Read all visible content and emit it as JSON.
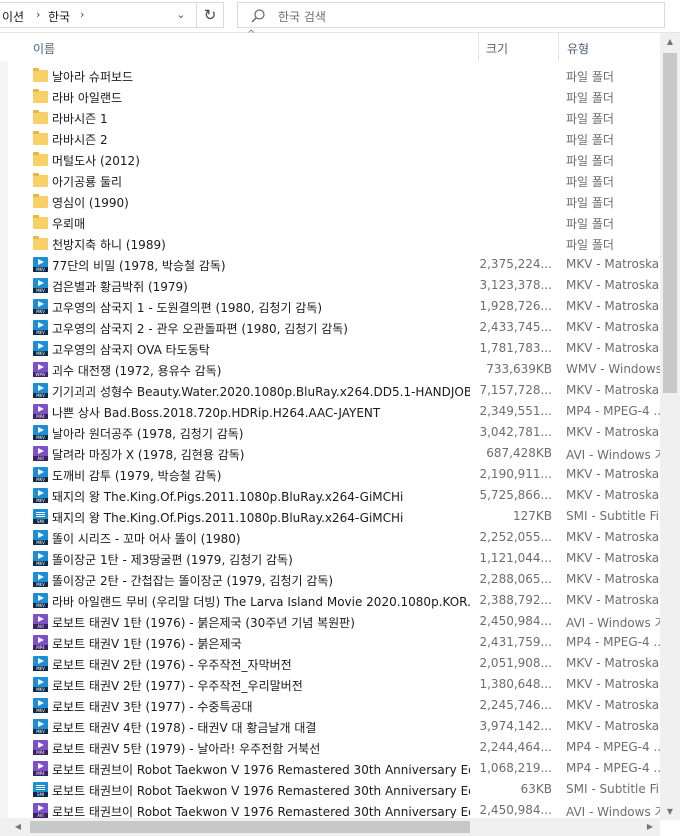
{
  "address": {
    "crumb1": "이션",
    "crumb2": "한국"
  },
  "search": {
    "placeholder": "한국 검색"
  },
  "header": {
    "name": "이름",
    "size": "크기",
    "type": "유형"
  },
  "rows": [
    {
      "icon": "folder",
      "name": "날아라 슈퍼보드",
      "size": "",
      "type": "파일 폴더"
    },
    {
      "icon": "folder",
      "name": "라바 아일랜드",
      "size": "",
      "type": "파일 폴더"
    },
    {
      "icon": "folder",
      "name": "라바시즌 1",
      "size": "",
      "type": "파일 폴더"
    },
    {
      "icon": "folder",
      "name": "라바시즌 2",
      "size": "",
      "type": "파일 폴더"
    },
    {
      "icon": "folder",
      "name": "머털도사 (2012)",
      "size": "",
      "type": "파일 폴더"
    },
    {
      "icon": "folder",
      "name": "아기공룡 둘리",
      "size": "",
      "type": "파일 폴더"
    },
    {
      "icon": "folder",
      "name": "영심이 (1990)",
      "size": "",
      "type": "파일 폴더"
    },
    {
      "icon": "folder",
      "name": "우뢰매",
      "size": "",
      "type": "파일 폴더"
    },
    {
      "icon": "folder",
      "name": "천방지축 하니 (1989)",
      "size": "",
      "type": "파일 폴더"
    },
    {
      "icon": "mkv",
      "name": "77단의 비밀 (1978, 박승철 감독)",
      "size": "2,375,224...",
      "type": "MKV - Matroska ..."
    },
    {
      "icon": "mkv",
      "name": "검은별과 황금박쥐 (1979)",
      "size": "3,123,378...",
      "type": "MKV - Matroska ..."
    },
    {
      "icon": "mkv",
      "name": "고우영의 삼국지 1 - 도원결의편 (1980, 김청기 감독)",
      "size": "1,928,726...",
      "type": "MKV - Matroska ..."
    },
    {
      "icon": "mkv",
      "name": "고우영의 삼국지 2 - 관우 오관돌파편 (1980, 김청기 감독)",
      "size": "2,433,745...",
      "type": "MKV - Matroska ..."
    },
    {
      "icon": "mkv",
      "name": "고우영의 삼국지 OVA 타도동탁",
      "size": "1,781,783...",
      "type": "MKV - Matroska ..."
    },
    {
      "icon": "wmv",
      "name": "괴수 대전쟁 (1972, 용유수 감독)",
      "size": "733,639KB",
      "type": "WMV - Windows ..."
    },
    {
      "icon": "mkv",
      "name": "기기괴괴 성형수 Beauty.Water.2020.1080p.BluRay.x264.DD5.1-HANDJOB",
      "size": "7,157,728...",
      "type": "MKV - Matroska ..."
    },
    {
      "icon": "mp4",
      "name": "나쁜 상사 Bad.Boss.2018.720p.HDRip.H264.AAC-JAYENT",
      "size": "2,349,551...",
      "type": "MP4 - MPEG-4 ..."
    },
    {
      "icon": "mkv",
      "name": "날아라 원더공주 (1978, 김청기 감독)",
      "size": "3,042,781...",
      "type": "MKV - Matroska ..."
    },
    {
      "icon": "avi",
      "name": "달려라 마징가 X (1978, 김현용 감독)",
      "size": "687,428KB",
      "type": "AVI - Windows 기..."
    },
    {
      "icon": "mkv",
      "name": "도깨비 감투 (1979, 박승철 감독)",
      "size": "2,190,911...",
      "type": "MKV - Matroska ..."
    },
    {
      "icon": "mkv",
      "name": "돼지의 왕 The.King.Of.Pigs.2011.1080p.BluRay.x264-GiMCHi",
      "size": "5,725,866...",
      "type": "MKV - Matroska ..."
    },
    {
      "icon": "smi",
      "name": "돼지의 왕 The.King.Of.Pigs.2011.1080p.BluRay.x264-GiMCHi",
      "size": "127KB",
      "type": "SMI - Subtitle File"
    },
    {
      "icon": "mkv",
      "name": "똘이 시리즈 - 꼬마 어사 똘이 (1980)",
      "size": "2,252,055...",
      "type": "MKV - Matroska ..."
    },
    {
      "icon": "mkv",
      "name": "똘이장군 1탄 - 제3땅굴편 (1979, 김청기 감독)",
      "size": "1,121,044...",
      "type": "MKV - Matroska ..."
    },
    {
      "icon": "mkv",
      "name": "똘이장군 2탄 - 간첩잡는 똘이장군 (1979, 김청기 감독)",
      "size": "2,288,065...",
      "type": "MKV - Matroska ..."
    },
    {
      "icon": "mkv",
      "name": "라바 아일랜드 무비 (우리말 더빙) The Larva Island Movie 2020.1080p.KOR...",
      "size": "2,388,792...",
      "type": "MKV - Matroska ..."
    },
    {
      "icon": "avi",
      "name": "로보트 태권V 1탄 (1976) - 붉은제국 (30주년 기념 복원판)",
      "size": "2,450,984...",
      "type": "AVI - Windows 기..."
    },
    {
      "icon": "mp4",
      "name": "로보트 태권V 1탄 (1976) - 붉은제국",
      "size": "2,431,759...",
      "type": "MP4 - MPEG-4 ..."
    },
    {
      "icon": "mkv",
      "name": "로보트 태권V 2탄 (1976) - 우주작전_자막버전",
      "size": "2,051,908...",
      "type": "MKV - Matroska ..."
    },
    {
      "icon": "mkv",
      "name": "로보트 태권V 2탄 (1977) - 우주작전_우리말버전",
      "size": "1,380,648...",
      "type": "MKV - Matroska ..."
    },
    {
      "icon": "mkv",
      "name": "로보트 태권V 3탄 (1977) - 수중특공대",
      "size": "2,245,746...",
      "type": "MKV - Matroska ..."
    },
    {
      "icon": "mkv",
      "name": "로보트 태권V 4탄 (1978) - 태권V 대 황금날개 대결",
      "size": "3,974,142...",
      "type": "MKV - Matroska ..."
    },
    {
      "icon": "mp4",
      "name": "로보트 태권V 5탄 (1979) - 날아라! 우주전함 거북선",
      "size": "2,244,464...",
      "type": "MP4 - MPEG-4 ..."
    },
    {
      "icon": "mp4",
      "name": "로보트 태권브이 Robot Taekwon V 1976 Remastered 30th Anniversary Editi...",
      "size": "1,068,219...",
      "type": "MP4 - MPEG-4 ..."
    },
    {
      "icon": "smi",
      "name": "로보트 태권브이 Robot Taekwon V 1976 Remastered 30th Anniversary Editi...",
      "size": "63KB",
      "type": "SMI - Subtitle File"
    },
    {
      "icon": "avi",
      "name": "로보트 태권브이 Robot Taekwon V 1976 Remastered 30th Anniversary Editi...",
      "size": "2,450,984...",
      "type": "AVI - Windows 기..."
    }
  ],
  "icon_labels": {
    "mkv": "MKV",
    "mp4": "MP4",
    "avi": "AVI",
    "wmv": "WMV",
    "smi": "SMI"
  },
  "colors": {
    "folder": "#f7d066",
    "video": "#1b8fd6",
    "purple": "#7d4fc9",
    "header_text": "#4c607a"
  }
}
